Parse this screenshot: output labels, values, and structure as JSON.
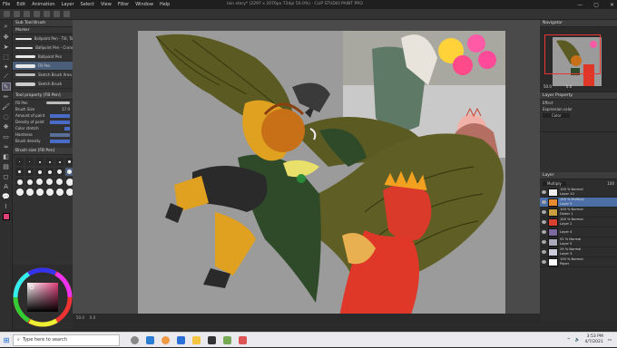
{
  "window": {
    "title": "lain story* (2297 x 2070px 72dpi 50.0%) - CLIP STUDIO PAINT PRO",
    "menu": [
      "File",
      "Edit",
      "Animation",
      "Layer",
      "Select",
      "View",
      "Filter",
      "Window",
      "Help"
    ],
    "controls": {
      "minimize": "—",
      "maximize": "▢",
      "close": "✕"
    }
  },
  "subtool": {
    "header": "Sub Tool Brush",
    "tab": "Marker",
    "brushes": [
      {
        "label": "Ballpoint Pen - Tilt, Texture"
      },
      {
        "label": "Ballpoint Pen - Crunchy"
      },
      {
        "label": "Ballpoint Pen"
      },
      {
        "label": "FB Pen"
      },
      {
        "label": "Sketch Brush Area"
      },
      {
        "label": "Sketch Brush"
      }
    ],
    "detail_header": "Tool property [FB Pen]",
    "brush_name": "FB Pen",
    "properties": [
      {
        "label": "Brush Size",
        "value": "17.0"
      },
      {
        "label": "Amount of paint",
        "value": "100"
      },
      {
        "label": "Density of paint",
        "value": "100"
      },
      {
        "label": "Color stretch",
        "value": "12"
      },
      {
        "label": "Hardness",
        "value": ""
      },
      {
        "label": "Brush density",
        "value": "100"
      }
    ],
    "size_header": "Brush size [FB Pen]",
    "sizes": [
      "0.7",
      "1",
      "1.5",
      "2",
      "2.5",
      "3",
      "4",
      "5",
      "6",
      "7",
      "8",
      "10",
      "12",
      "15",
      "17",
      "20",
      "25",
      "30",
      "40",
      "50",
      "60",
      "70",
      "80",
      "100"
    ]
  },
  "canvas": {
    "zoom": "50.0",
    "angle": "0.0"
  },
  "navigator": {
    "header": "Navigator",
    "zoom_value": "50.0",
    "angle_value": "0.0"
  },
  "layer_property": {
    "header": "Layer Property",
    "effect_label": "Effect",
    "expression_label": "Expression color",
    "expression_value": "Color"
  },
  "layers": {
    "header": "Layer",
    "blend_mode": "Multiply",
    "opacity": "100",
    "items": [
      {
        "mode": "100 % Normal",
        "name": "Layer 10",
        "selected": false
      },
      {
        "mode": "100 % Multiply",
        "name": "Layer 9",
        "selected": true
      },
      {
        "mode": "100 % Normal",
        "name": "Folder 1",
        "selected": false
      },
      {
        "mode": "100 % Normal",
        "name": "Layer 2",
        "selected": false
      },
      {
        "mode": "",
        "name": "Layer 4",
        "selected": false
      },
      {
        "mode": "52 % Normal",
        "name": "Layer 5",
        "selected": false
      },
      {
        "mode": "29 % Normal",
        "name": "Layer 3",
        "selected": false
      },
      {
        "mode": "100 % Normal",
        "name": "Paper",
        "selected": false
      }
    ]
  },
  "taskbar": {
    "search_placeholder": "Type here to search",
    "time": "3:53 PM",
    "date": "4/7/2021"
  },
  "colors": {
    "accent": "#4d6fa8",
    "canvas_bg": "#9b9b9b",
    "wing": "#5a5a22",
    "skin": "#e0a020",
    "red": "#d93a2a"
  }
}
